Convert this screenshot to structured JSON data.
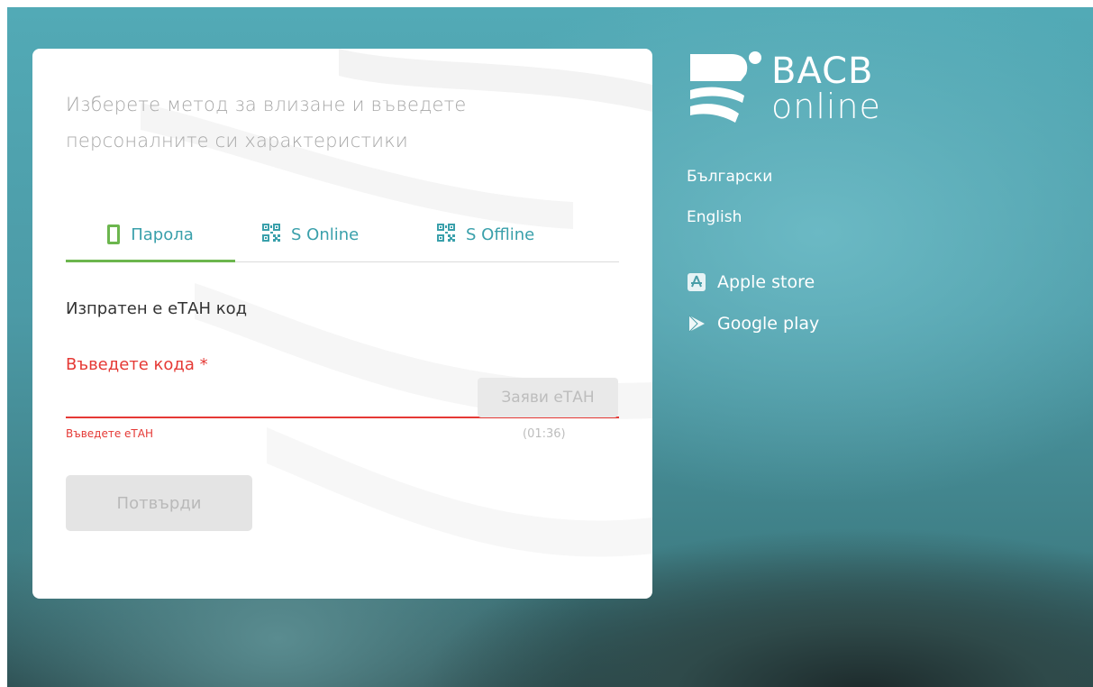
{
  "login": {
    "heading": "Изберете метод за влизане и въведете персоналните си характеристики",
    "tabs": [
      {
        "label": "Парола",
        "icon": "phone-icon",
        "active": true
      },
      {
        "label": "S Online",
        "icon": "qr-code-icon",
        "active": false
      },
      {
        "label": "S Offline",
        "icon": "qr-code-icon",
        "active": false
      }
    ],
    "sent_message": "Изпратен е еТАН код",
    "code_label": "Въведете кода *",
    "code_value": "",
    "request_button": "Заяви еТАН",
    "error_message": "Въведете еТАН",
    "timer": "(01:36)",
    "confirm_button": "Потвърди"
  },
  "brand": {
    "name_top": "BACB",
    "name_bottom": "online"
  },
  "languages": [
    "Български",
    "English"
  ],
  "stores": [
    {
      "label": "Apple store",
      "icon": "app-store-icon"
    },
    {
      "label": "Google play",
      "icon": "google-play-icon"
    }
  ],
  "colors": {
    "accent_teal": "#3aa0ab",
    "active_green": "#6cb64e",
    "error_red": "#e53935",
    "background_teal": "#52aab6"
  }
}
